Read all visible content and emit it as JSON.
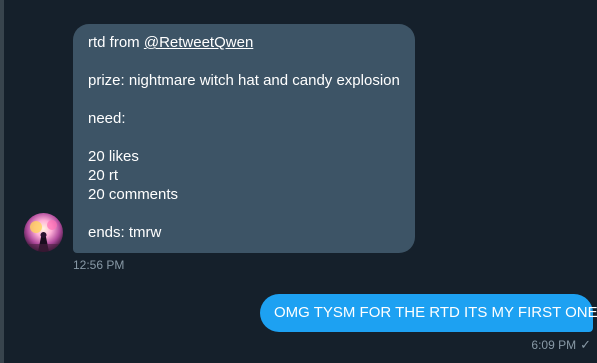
{
  "messages": {
    "incoming": {
      "line_prefix": "rtd from ",
      "mention": "@RetweetQwen",
      "prize": "prize: nightmare witch hat and candy explosion",
      "need": "need:",
      "likes": "20 likes",
      "rt": "20 rt",
      "comments": "20 comments",
      "ends": "ends: tmrw",
      "time": "12:56 PM"
    },
    "outgoing": {
      "text": "OMG TYSM FOR THE RTD ITS MY FIRST ONE!!",
      "time": "6:09 PM",
      "status_icon": "checkmark-icon"
    }
  },
  "colors": {
    "background": "#15202b",
    "incoming_bubble": "#3d5466",
    "outgoing_bubble": "#1da1f2",
    "meta_text": "#8899a6"
  }
}
